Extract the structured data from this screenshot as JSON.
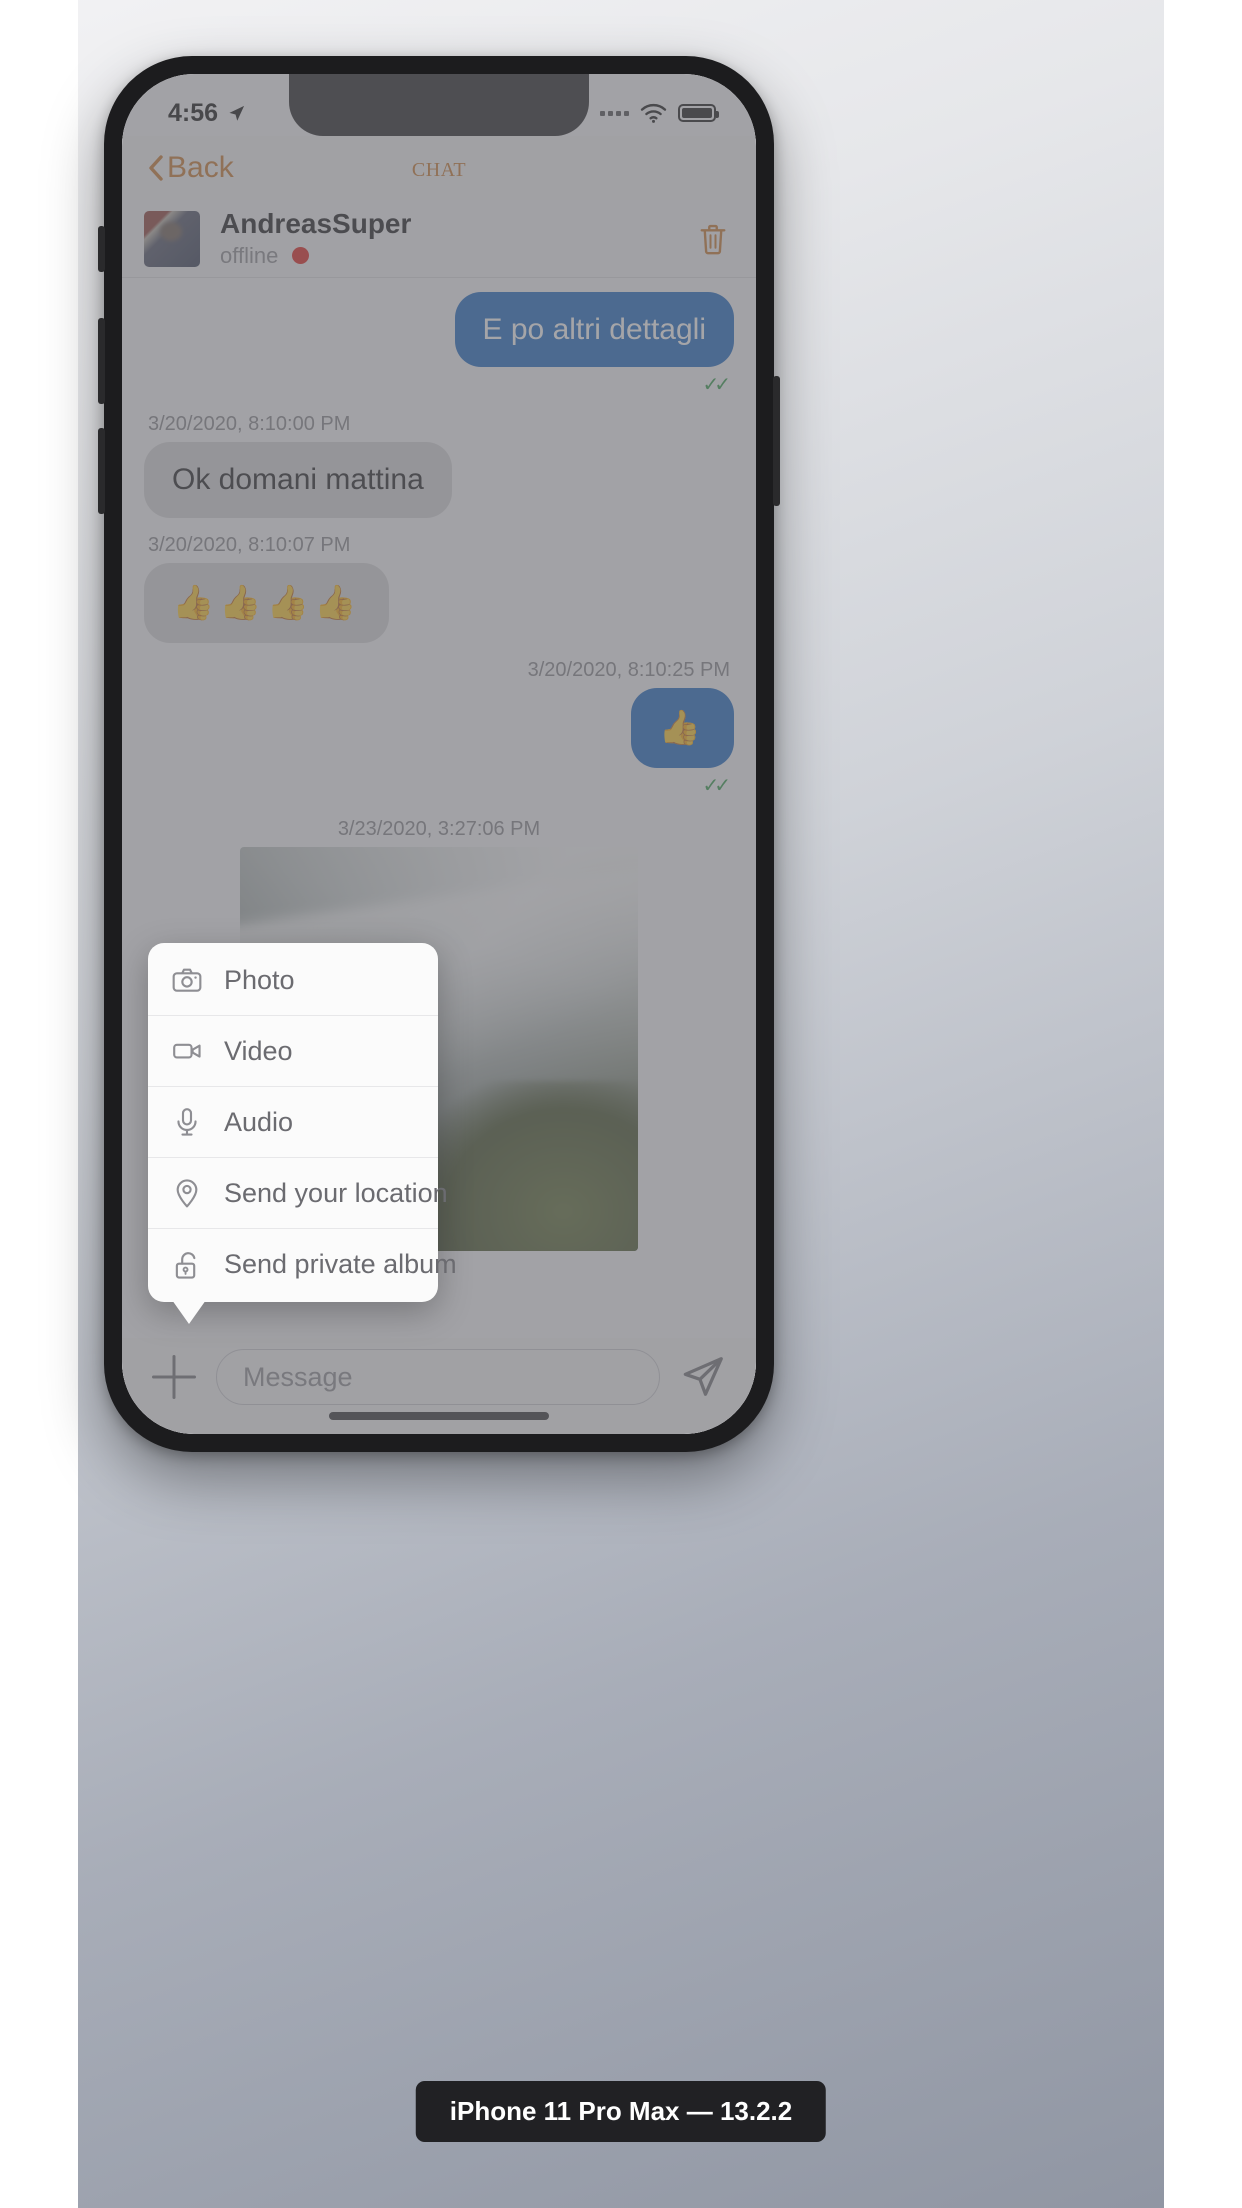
{
  "status_bar": {
    "time": "4:56",
    "location_icon": "location-arrow-icon",
    "signal_icon": "signal-dots-icon",
    "wifi_icon": "wifi-icon",
    "battery_icon": "battery-full-icon"
  },
  "navbar": {
    "back_label": "Back",
    "back_icon": "chevron-left-icon",
    "title": "CHAT",
    "accent_color": "#c9762a"
  },
  "contact": {
    "name": "AndreasSuper",
    "status": "offline",
    "status_dot_color": "#e01b17",
    "avatar_icon": "user-avatar",
    "delete_icon": "trash-icon"
  },
  "messages": [
    {
      "id": "m1",
      "direction": "out",
      "type": "text",
      "text": "E po altri dettagli",
      "timestamp": "",
      "receipt": "✓✓"
    },
    {
      "id": "m2",
      "direction": "in",
      "type": "text",
      "text": "Ok domani mattina",
      "timestamp": "3/20/2020, 8:10:00 PM",
      "receipt": ""
    },
    {
      "id": "m3",
      "direction": "in",
      "type": "emoji",
      "text": "👍👍👍👍",
      "timestamp": "3/20/2020, 8:10:07 PM",
      "receipt": ""
    },
    {
      "id": "m4",
      "direction": "out",
      "type": "emoji",
      "text": "👍",
      "timestamp": "3/20/2020, 8:10:25 PM",
      "receipt": "✓✓"
    },
    {
      "id": "m5",
      "direction": "center",
      "type": "photo",
      "text": "",
      "timestamp": "3/23/2020, 3:27:06 PM",
      "receipt": ""
    }
  ],
  "attach_menu": {
    "items": [
      {
        "label": "Photo",
        "icon": "camera-icon"
      },
      {
        "label": "Video",
        "icon": "video-camera-icon"
      },
      {
        "label": "Audio",
        "icon": "microphone-icon"
      },
      {
        "label": "Send your location",
        "icon": "location-pin-icon"
      },
      {
        "label": "Send private album",
        "icon": "unlocked-padlock-icon"
      }
    ]
  },
  "composer": {
    "add_icon": "plus-icon",
    "input_value": "",
    "input_placeholder": "Message",
    "send_icon": "send-paper-plane-icon"
  },
  "device_caption": "iPhone 11 Pro Max — 13.2.2",
  "colors": {
    "bubble_out": "#1564c0",
    "bubble_in": "#d6d6d8",
    "receipt": "#2e9a46"
  }
}
